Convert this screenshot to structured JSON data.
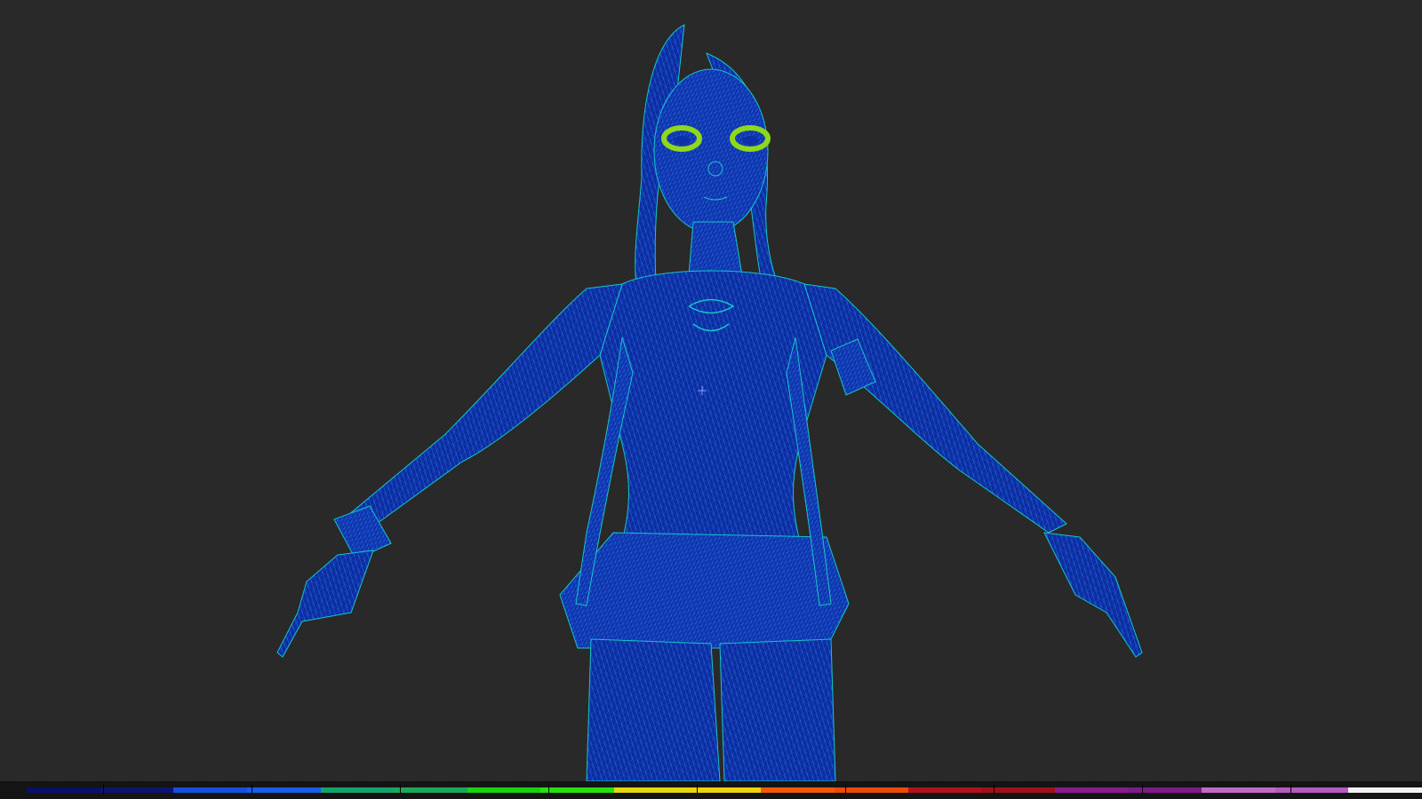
{
  "viewport": {
    "mode_icon": "wireframe-shader-complexity",
    "background_color": "#2c2c2c",
    "mesh_fill_color": "#0d2a9e",
    "mesh_line_color": "#1f6fe0",
    "mesh_edge_color": "#14c6c9",
    "eye_highlight_color": "#8fd81a"
  },
  "complexity_legend": {
    "colors": [
      "#0a0f6b",
      "#0c1470",
      "#1251e0",
      "#155ee8",
      "#16a36a",
      "#1aa85a",
      "#19d20f",
      "#26e00f",
      "#e2d80d",
      "#eed20a",
      "#f25a0a",
      "#ec4a08",
      "#b0121b",
      "#a1101a",
      "#8c1a8e",
      "#7e1a8a",
      "#c06ac8",
      "#b45ac0",
      "#f2f2f2"
    ]
  }
}
